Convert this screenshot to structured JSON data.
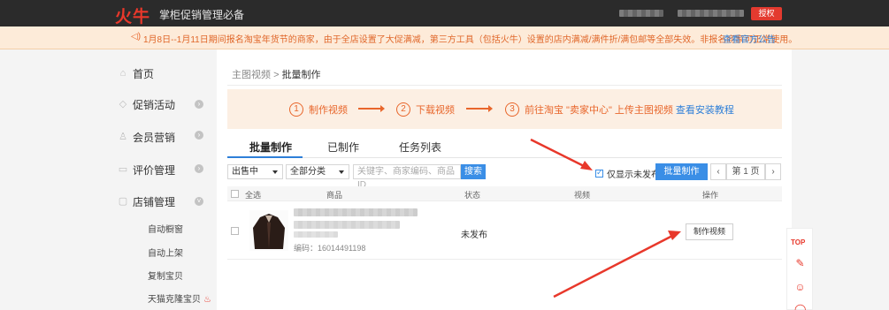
{
  "topbar": {
    "logo": "火牛",
    "tagline": "掌柜促销管理必备",
    "auth_label": "授权"
  },
  "notice": {
    "text": "1月8日--1月11日期间报名淘宝年货节的商家，由于全店设置了大促满减，第三方工具（包括火牛）设置的店内满减/满件折/满包邮等全部失效。非报名商家可正常使用。",
    "link": "查看官方公告"
  },
  "sidebar": {
    "items": [
      {
        "label": "首页",
        "icon": "home-icon"
      },
      {
        "label": "促销活动",
        "icon": "tag-icon"
      },
      {
        "label": "会员营销",
        "icon": "user-icon"
      },
      {
        "label": "评价管理",
        "icon": "comment-icon"
      },
      {
        "label": "店铺管理",
        "icon": "shop-icon"
      }
    ],
    "subitems": [
      "自动橱窗",
      "自动上架",
      "复制宝贝",
      "天猫克隆宝贝"
    ]
  },
  "breadcrumb": {
    "parent": "主图视频",
    "sep": ">",
    "current": "批量制作"
  },
  "steps": [
    {
      "num": "1",
      "label": "制作视频"
    },
    {
      "num": "2",
      "label": "下载视频"
    },
    {
      "num": "3",
      "label": "前往淘宝 \"卖家中心\" 上传主图视频",
      "link": "查看安装教程"
    }
  ],
  "tabs": [
    "批量制作",
    "已制作",
    "任务列表"
  ],
  "filters": {
    "status": "出售中",
    "category": "全部分类",
    "search_placeholder": "关键字、商家编码、商品ID",
    "search_button": "搜索",
    "only_unpublished": "仅显示未发布",
    "batch_button": "批量制作",
    "page": "第 1 页"
  },
  "table": {
    "headers": [
      "全选",
      "商品",
      "状态",
      "视频",
      "操作"
    ],
    "rows": [
      {
        "code": "编码：16014491198",
        "status": "未发布",
        "action": "制作视频"
      }
    ]
  },
  "float": {
    "top": "TOP"
  }
}
